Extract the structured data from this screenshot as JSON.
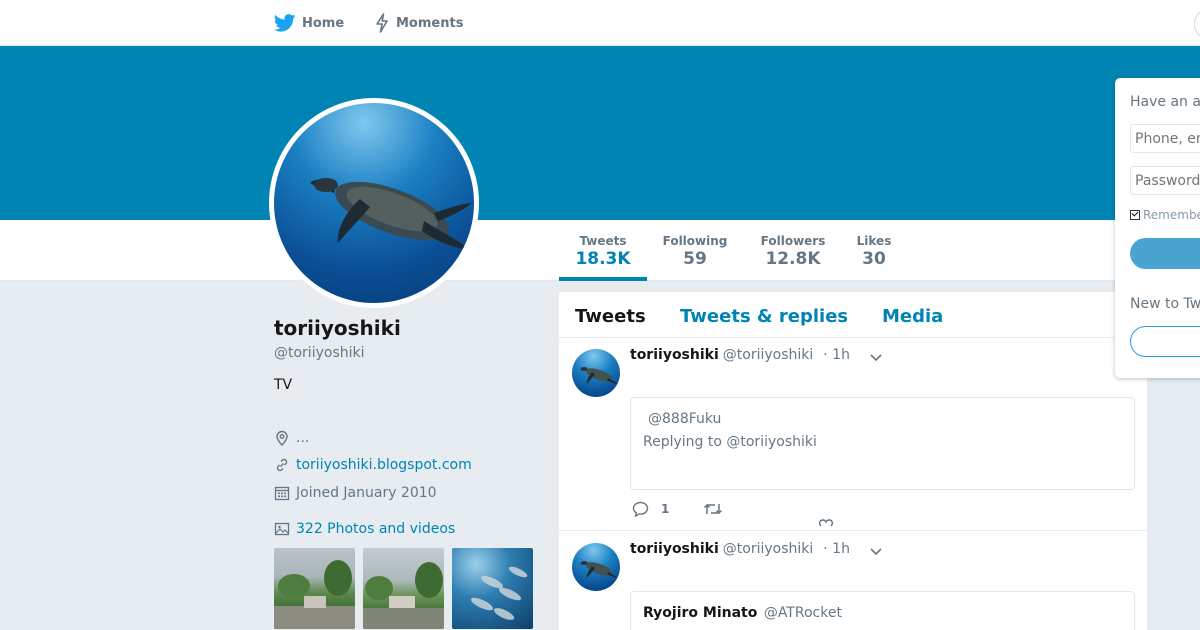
{
  "nav": {
    "home_label": "Home",
    "moments_label": "Moments"
  },
  "profile": {
    "name": "toriiyoshiki",
    "handle": "@toriiyoshiki",
    "bio": "TV",
    "location": "...",
    "url": "toriiyoshiki.blogspot.com",
    "joined": "Joined January 2010",
    "photos_label": "322 Photos and videos"
  },
  "stats": {
    "tweets_label": "Tweets",
    "tweets_value": "18.3K",
    "following_label": "Following",
    "following_value": "59",
    "followers_label": "Followers",
    "followers_value": "12.8K",
    "likes_label": "Likes",
    "likes_value": "30"
  },
  "tabs": {
    "tweets": "Tweets",
    "replies": "Tweets & replies",
    "media": "Media"
  },
  "tweets": [
    {
      "name": "toriiyoshiki",
      "handle": "@toriiyoshiki",
      "time": "· 1h",
      "quote_line1": "@888Fuku",
      "quote_line2": "Replying to @toriiyoshiki",
      "reply_count": "1"
    },
    {
      "name": "toriiyoshiki",
      "handle": "@toriiyoshiki",
      "time": "· 1h",
      "quote_name": "Ryojiro Minato",
      "quote_handle": "@ATRocket"
    }
  ],
  "login": {
    "title": "Have an a",
    "phone_placeholder": "Phone, em",
    "password_placeholder": "Password",
    "remember": "Remember",
    "new_label": "New to Tw"
  },
  "colors": {
    "brand": "#0084b4",
    "background": "#e6ecf0"
  }
}
